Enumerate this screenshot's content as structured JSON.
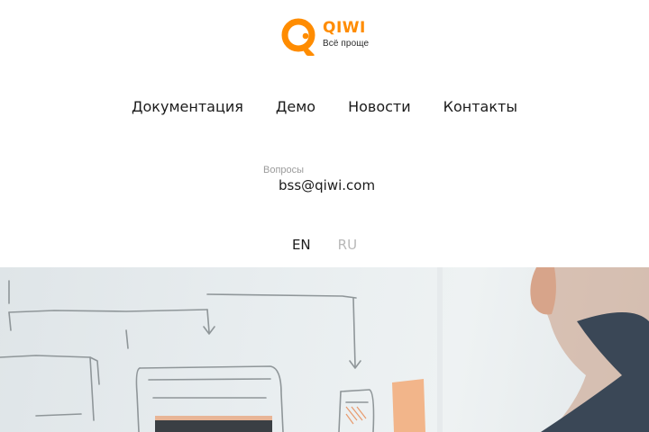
{
  "header": {
    "logo": {
      "brand": "QIWI",
      "tagline": "Всё проще",
      "icon": "qiwi-logo-icon",
      "brand_color": "#FF8C00"
    }
  },
  "nav": {
    "items": [
      {
        "label": "Документация"
      },
      {
        "label": "Демо"
      },
      {
        "label": "Новости"
      },
      {
        "label": "Контакты"
      }
    ]
  },
  "contact": {
    "label": "Вопросы",
    "email": "bss@qiwi.com"
  },
  "language": {
    "options": [
      {
        "label": "EN",
        "active": true
      },
      {
        "label": "RU",
        "active": false
      }
    ]
  },
  "hero": {
    "image": "whiteboard-sketch-photo"
  }
}
